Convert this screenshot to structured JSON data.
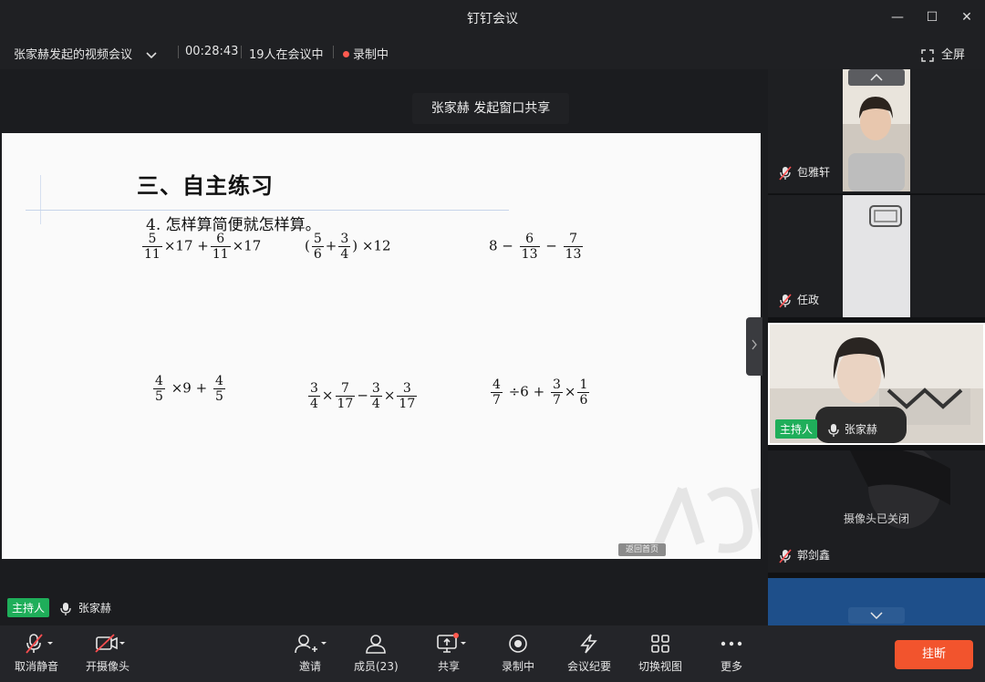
{
  "window": {
    "title": "钉钉会议",
    "min": "—",
    "max": "☐",
    "close": "✕"
  },
  "meeting": {
    "name": "张家赫发起的视频会议",
    "duration": "00:28:43",
    "participants": "19人在会议中",
    "recording": "录制中",
    "fullscreen": "全屏"
  },
  "share_banner": "张家赫 发起窗口共享",
  "slide": {
    "heading": "三、自主练习",
    "question": "4. 怎样算简便就怎样算。",
    "back_home": "返回首页",
    "expressions": {
      "e1": {
        "a_num": "5",
        "a_den": "11",
        "op1": "×17 +",
        "b_num": "6",
        "b_den": "11",
        "op2": "×17"
      },
      "e2": {
        "lp": "(",
        "a_num": "5",
        "a_den": "6",
        "plus": "+",
        "b_num": "3",
        "b_den": "4",
        "rp": ")",
        "tail": "×12"
      },
      "e3": {
        "head": "8 −",
        "a_num": "6",
        "a_den": "13",
        "minus": "−",
        "b_num": "7",
        "b_den": "13"
      },
      "e4": {
        "a_num": "4",
        "a_den": "5",
        "op1": "×9 +",
        "b_num": "4",
        "b_den": "5"
      },
      "e5": {
        "a_num": "3",
        "a_den": "4",
        "op1": "×",
        "b_num": "7",
        "b_den": "17",
        "op2": "−",
        "c_num": "3",
        "c_den": "4",
        "op3": "×",
        "d_num": "3",
        "d_den": "17"
      },
      "e6": {
        "a_num": "4",
        "a_den": "7",
        "op1": "÷6 +",
        "b_num": "3",
        "b_den": "7",
        "op2": "×",
        "c_num": "1",
        "c_den": "6"
      }
    }
  },
  "stage_speaker": {
    "role": "主持人",
    "name": "张家赫"
  },
  "participants_panel": [
    {
      "name": "包雅轩",
      "muted": true
    },
    {
      "name": "任政",
      "muted": true
    },
    {
      "name": "张家赫",
      "role": "主持人",
      "muted": false
    },
    {
      "name": "郭剑鑫",
      "muted": true,
      "status": "摄像头已关闭"
    }
  ],
  "toolbar": {
    "unmute": "取消静音",
    "camera": "开摄像头",
    "invite": "邀请",
    "members": "成员(23)",
    "share": "共享",
    "recording": "录制中",
    "minutes": "会议纪要",
    "switch_view": "切换视图",
    "more": "更多",
    "hangup": "挂断"
  },
  "colors": {
    "accent_green": "#1fae5a",
    "hangup_red": "#f2542d",
    "record_red": "#ff5a4f",
    "active_border": "#ffffff"
  }
}
